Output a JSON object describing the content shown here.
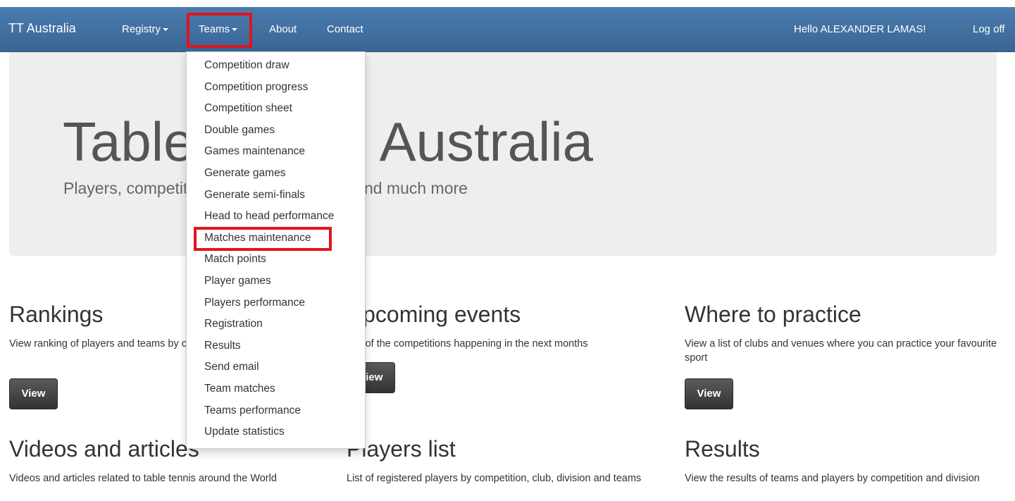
{
  "navbar": {
    "brand": "TT Australia",
    "items": [
      "Registry",
      "Teams",
      "About",
      "Contact"
    ],
    "greeting": "Hello ALEXANDER LAMAS!",
    "logoff": "Log off",
    "color": "#3e6a9a"
  },
  "dropdown": {
    "items": [
      "Competition draw",
      "Competition progress",
      "Competition sheet",
      "Double games",
      "Games maintenance",
      "Generate games",
      "Generate semi-finals",
      "Head to head performance",
      "Matches maintenance",
      "Match points",
      "Player games",
      "Players performance",
      "Registration",
      "Results",
      "Send email",
      "Team matches",
      "Teams performance",
      "Update statistics"
    ]
  },
  "highlight_color": "#e0151b",
  "jumbotron": {
    "title": "Table Tennis Australia",
    "subtitle": "Players, competitions, ranking, statistics and much more"
  },
  "features": [
    {
      "title": "Rankings",
      "text": "View ranking of players and teams by competition and division",
      "button": "View"
    },
    {
      "title": "Upcoming events",
      "text": "List of the competitions happening in the next months",
      "button": "View"
    },
    {
      "title": "Where to practice",
      "text": "View a list of clubs and venues where you can practice your favourite sport",
      "button": "View"
    },
    {
      "title": "Videos and articles",
      "text": "Videos and articles related to table tennis around the World"
    },
    {
      "title": "Players list",
      "text": "List of registered players by competition, club, division and teams"
    },
    {
      "title": "Results",
      "text": "View the results of teams and players by competition and division"
    }
  ]
}
